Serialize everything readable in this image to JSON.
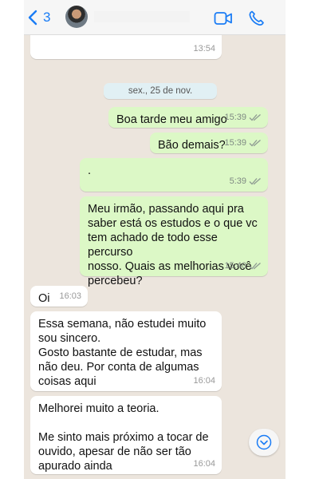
{
  "header": {
    "back_count": "3",
    "icons": [
      "back-chevron-icon",
      "video-call-icon",
      "voice-call-icon"
    ]
  },
  "messages_top": {
    "partial_time": "13:54"
  },
  "date_separator": "sex., 25 de nov.",
  "messages": [
    {
      "direction": "out",
      "text": "Boa tarde meu amigo",
      "time": "15:39"
    },
    {
      "direction": "out",
      "text": "Bão demais?",
      "time": "15:39"
    },
    {
      "direction": "out",
      "text": ".",
      "time": "5:39"
    },
    {
      "direction": "out",
      "text": "Meu irmão, passando aqui pra\nsaber está os estudos e o que vc\ntem achado de todo esse percurso\nnosso. Quais as melhorias você\npercebeu?",
      "time": "15:40"
    },
    {
      "direction": "in",
      "text": "Oi",
      "time": "16:03"
    },
    {
      "direction": "in",
      "text": "Essa semana, não estudei muito\nsou sincero.\nGosto bastante de estudar, mas\nnão deu. Por conta de algumas\ncoisas aqui",
      "time": "16:04"
    },
    {
      "direction": "in",
      "text": "Melhorei muito a teoria.\n\nMe sinto mais próximo a tocar de\nouvido, apesar de não ser tão\napurado ainda",
      "time": "16:04"
    }
  ],
  "colors": {
    "chat_background": "#ece5dd",
    "outgoing_bubble": "#dcf8c6",
    "incoming_bubble": "#ffffff",
    "accent": "#1a7cf5",
    "read_ticks": "#8e9a92"
  }
}
